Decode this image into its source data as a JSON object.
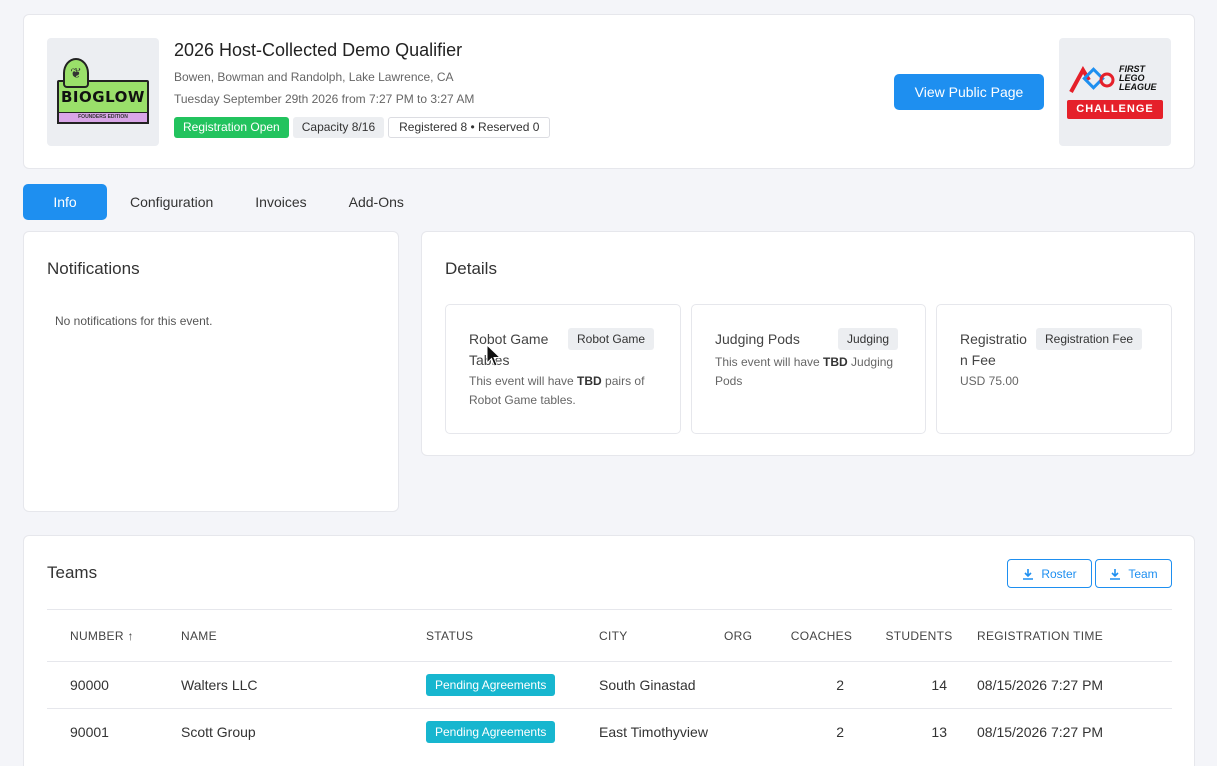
{
  "event": {
    "title": "2026 Host-Collected Demo Qualifier",
    "location": "Bowen, Bowman and Randolph, Lake Lawrence, CA",
    "date": "Tuesday September 29th 2026 from 7:27 PM to 3:27 AM",
    "badges": {
      "status": "Registration Open",
      "capacity": "Capacity 8/16",
      "registered": "Registered 8 • Reserved 0"
    },
    "logo": {
      "text": "BIOGLOW",
      "subtext": "FOUNDERS EDITION"
    },
    "public_button": "View Public Page",
    "program_logo": {
      "line1": "FIRST",
      "line2": "LEGO",
      "line3": "LEAGUE",
      "tag": "CHALLENGE"
    }
  },
  "tabs": [
    "Info",
    "Configuration",
    "Invoices",
    "Add-Ons"
  ],
  "notifications": {
    "title": "Notifications",
    "empty": "No notifications for this event."
  },
  "details": {
    "title": "Details",
    "cards": [
      {
        "title": "Robot Game Tables",
        "tag": "Robot Game",
        "pre": "This event will have ",
        "bold": "TBD",
        "post": " pairs of Robot Game tables."
      },
      {
        "title": "Judging Pods",
        "tag": "Judging",
        "pre": "This event will have ",
        "bold": "TBD",
        "post": " Judging Pods"
      },
      {
        "title": "Registration Fee",
        "tag": "Registration Fee",
        "pre": "USD 75.00",
        "bold": "",
        "post": ""
      }
    ]
  },
  "teams": {
    "title": "Teams",
    "roster_button": "Roster",
    "team_button": "Team",
    "columns": [
      "NUMBER",
      "NAME",
      "STATUS",
      "CITY",
      "ORG",
      "COACHES",
      "STUDENTS",
      "REGISTRATION TIME"
    ],
    "rows": [
      {
        "number": "90000",
        "name": "Walters LLC",
        "status": "Pending Agreements",
        "city": "South Ginastad",
        "org": "",
        "coaches": "2",
        "students": "14",
        "registered": "08/15/2026 7:27 PM"
      },
      {
        "number": "90001",
        "name": "Scott Group",
        "status": "Pending Agreements",
        "city": "East Timothyview",
        "org": "",
        "coaches": "2",
        "students": "13",
        "registered": "08/15/2026 7:27 PM"
      }
    ]
  },
  "colors": {
    "primary": "#1e8ff0",
    "success": "#22c35e",
    "info": "#17b6cf",
    "challenge": "#e5202a"
  },
  "icons": {
    "sort": "arrow-up-icon",
    "download": "download-icon",
    "cursor": "mouse-pointer-icon"
  }
}
